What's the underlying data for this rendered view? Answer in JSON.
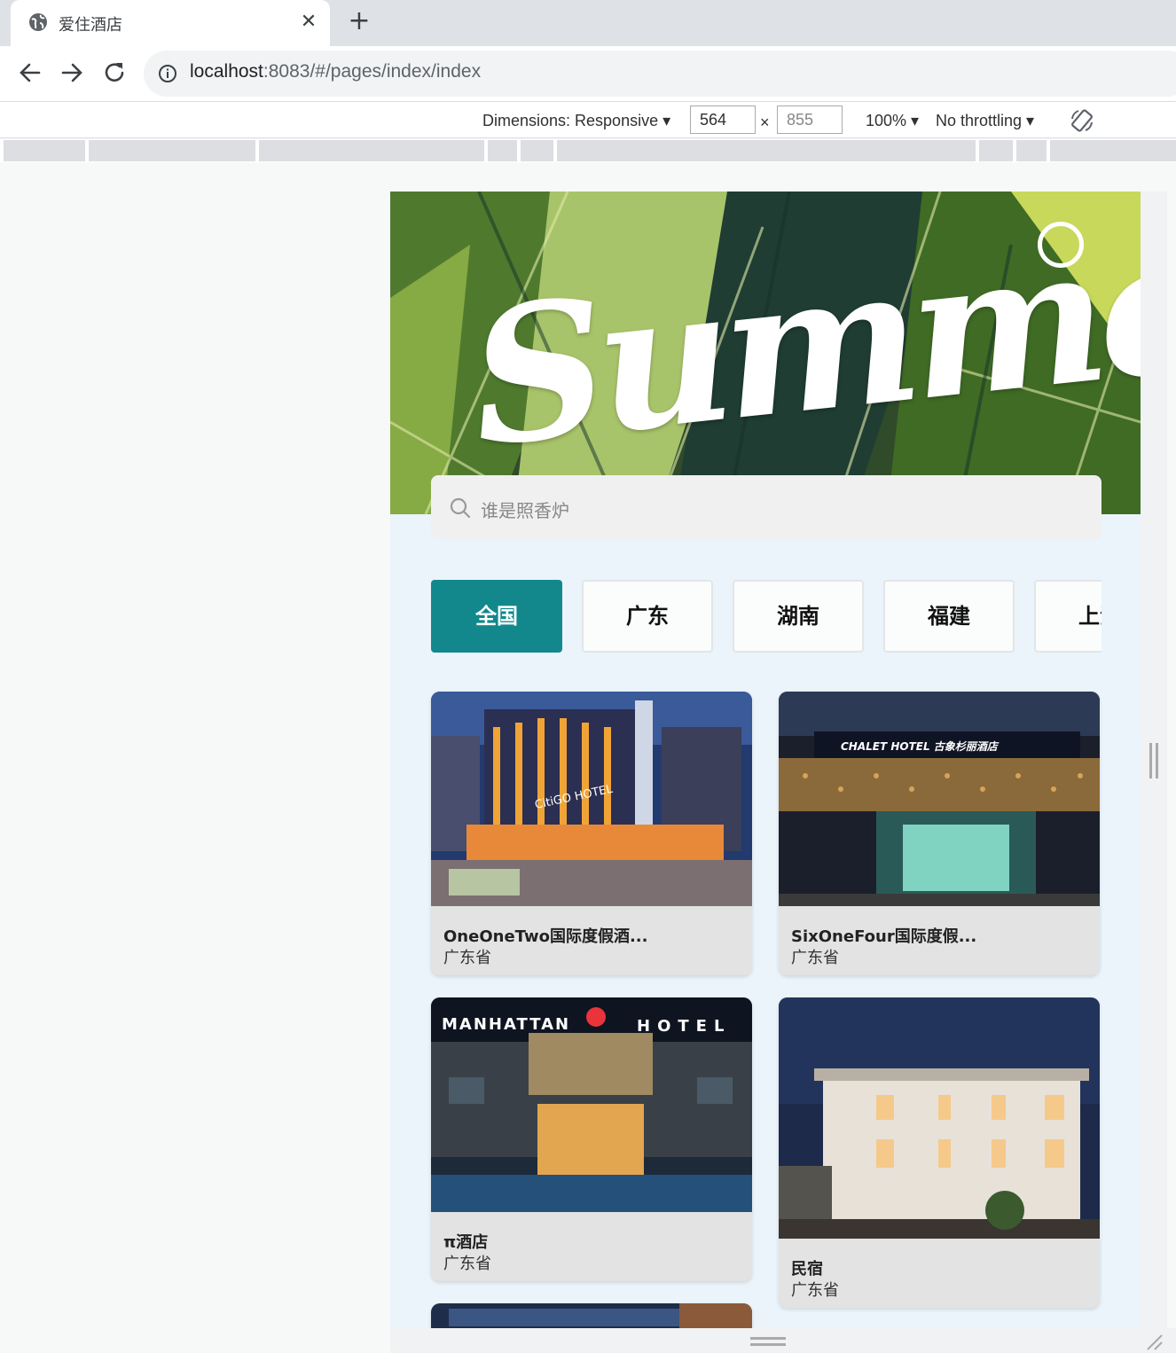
{
  "browser": {
    "tab": {
      "title": "爱住酒店",
      "close": "✕"
    },
    "new_tab": "+",
    "url": {
      "host": "localhost",
      "rest": ":8083/#/pages/index/index"
    }
  },
  "devtools": {
    "dimensions_label": "Dimensions: Responsive ▾",
    "width": "564",
    "height": "855",
    "times": "×",
    "zoom": "100% ▾",
    "throttling": "No throttling ▾"
  },
  "page": {
    "banner": {
      "text": "Summer"
    },
    "search": {
      "placeholder": "谁是照香炉"
    },
    "categories": [
      {
        "label": "全国",
        "active": true
      },
      {
        "label": "广东",
        "active": false
      },
      {
        "label": "湖南",
        "active": false
      },
      {
        "label": "福建",
        "active": false
      },
      {
        "label": "上海",
        "active": false
      }
    ],
    "hotels": [
      {
        "name": "OneOneTwo国际度假酒...",
        "province": "广东省",
        "sign": "CitiGO HOTEL"
      },
      {
        "name": "SixOneFour国际度假...",
        "province": "广东省",
        "sign": "CHALET HOTEL 古象杉丽酒店"
      },
      {
        "name": "π酒店",
        "province": "广东省",
        "sign_left": "MANHATTAN",
        "sign_right": "HOTEL"
      },
      {
        "name": "民宿",
        "province": "广东省"
      }
    ]
  },
  "colors": {
    "accent": "#12888d",
    "device_bg": "#eaf4fa"
  }
}
